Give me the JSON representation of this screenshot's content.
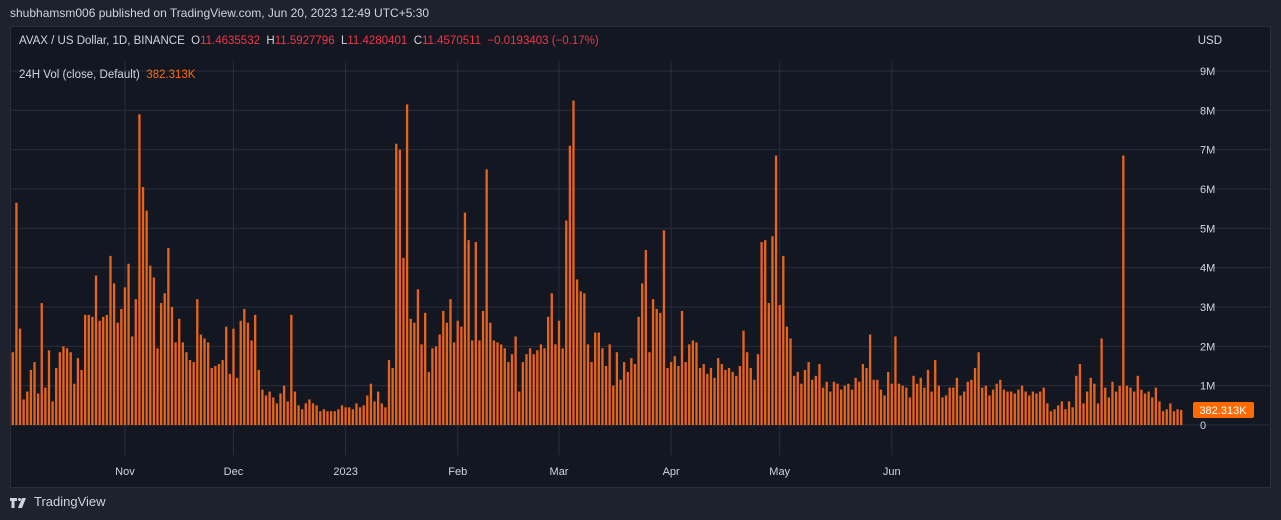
{
  "header": {
    "publisher_line": "shubhamsm006 published on TradingView.com, Jun 20, 2023 12:49 UTC+5:30"
  },
  "legend": {
    "symbol": "AVAX / US Dollar, 1D, BINANCE",
    "o_label": "O",
    "o_value": "11.4635532",
    "h_label": "H",
    "h_value": "11.5927796",
    "l_label": "L",
    "l_value": "11.4280401",
    "c_label": "C",
    "c_value": "11.4570511",
    "change": "−0.0193403 (−0.17%)",
    "currency": "USD"
  },
  "indicator": {
    "name": "24H Vol (close, Default)",
    "value": "382.313K"
  },
  "footer": {
    "brand": "TradingView"
  },
  "colors": {
    "bar": "#e8641c",
    "label_bg": "#ff6a00",
    "grid": "#2a2e39"
  },
  "chart_data": {
    "type": "bar",
    "series": [
      {
        "name": "24H Vol (close, Default)"
      }
    ],
    "y_ticks": [
      "0",
      "1M",
      "2M",
      "3M",
      "4M",
      "5M",
      "6M",
      "7M",
      "8M",
      "9M"
    ],
    "y_tick_values": [
      0,
      1000000,
      2000000,
      3000000,
      4000000,
      5000000,
      6000000,
      7000000,
      8000000,
      9000000
    ],
    "ylim": [
      0,
      9000000
    ],
    "x_ticks": [
      {
        "label": "Nov",
        "index": 31
      },
      {
        "label": "Dec",
        "index": 61
      },
      {
        "label": "2023",
        "index": 92
      },
      {
        "label": "Feb",
        "index": 123
      },
      {
        "label": "Mar",
        "index": 151
      },
      {
        "label": "Apr",
        "index": 182
      },
      {
        "label": "May",
        "index": 212
      },
      {
        "label": "Jun",
        "index": 243
      }
    ],
    "last_value_label": "382.313K",
    "last_value": 382313,
    "values": [
      1.85,
      5.65,
      2.45,
      0.65,
      0.85,
      1.4,
      1.6,
      0.8,
      3.1,
      0.95,
      1.9,
      0.6,
      1.45,
      1.85,
      2.0,
      1.95,
      1.85,
      1.05,
      1.7,
      1.4,
      2.8,
      2.8,
      2.75,
      3.8,
      2.65,
      2.75,
      2.8,
      4.3,
      3.6,
      2.6,
      2.95,
      3.5,
      4.1,
      2.25,
      3.2,
      7.9,
      6.05,
      5.45,
      4.05,
      3.75,
      1.95,
      3.1,
      3.35,
      4.5,
      3.0,
      2.1,
      2.7,
      2.1,
      1.85,
      1.65,
      1.6,
      3.2,
      2.3,
      2.2,
      2.1,
      1.45,
      1.5,
      1.55,
      1.65,
      2.5,
      1.3,
      2.45,
      1.2,
      2.65,
      2.95,
      2.6,
      2.15,
      2.8,
      1.4,
      0.9,
      0.75,
      0.85,
      0.7,
      0.55,
      0.8,
      1.0,
      0.6,
      2.8,
      0.85,
      0.5,
      0.4,
      0.55,
      0.65,
      0.55,
      0.5,
      0.35,
      0.4,
      0.35,
      0.35,
      0.35,
      0.4,
      0.5,
      0.45,
      0.45,
      0.4,
      0.55,
      0.45,
      0.5,
      0.75,
      1.05,
      0.6,
      0.85,
      0.55,
      0.45,
      1.65,
      1.45,
      7.15,
      7.0,
      4.25,
      8.15,
      2.7,
      2.6,
      3.45,
      2.05,
      2.85,
      1.35,
      1.95,
      2.0,
      2.3,
      2.9,
      2.6,
      3.2,
      2.1,
      2.65,
      2.5,
      5.4,
      4.7,
      2.15,
      4.65,
      2.15,
      2.9,
      6.5,
      2.6,
      2.15,
      2.1,
      2.05,
      1.95,
      1.6,
      1.8,
      2.25,
      0.85,
      1.6,
      1.8,
      1.95,
      1.8,
      1.9,
      2.05,
      1.95,
      2.75,
      3.35,
      2.05,
      2.65,
      1.95,
      5.2,
      7.1,
      8.25,
      3.7,
      3.4,
      3.35,
      2.05,
      1.6,
      2.35,
      2.35,
      1.95,
      1.5,
      2.05,
      1.0,
      1.85,
      1.15,
      1.6,
      1.35,
      1.7,
      1.55,
      2.75,
      3.6,
      4.45,
      1.85,
      3.2,
      2.95,
      2.85,
      4.95,
      1.45,
      1.6,
      1.75,
      1.5,
      2.9,
      1.6,
      2.05,
      2.15,
      2.1,
      1.45,
      1.55,
      1.3,
      1.45,
      1.2,
      1.7,
      1.55,
      1.4,
      1.45,
      1.35,
      1.25,
      1.5,
      2.4,
      1.85,
      1.45,
      1.15,
      1.8,
      4.65,
      4.7,
      3.1,
      4.8,
      6.85,
      3.05,
      4.3,
      2.5,
      2.2,
      1.25,
      1.35,
      1.05,
      1.4,
      1.6,
      1.15,
      1.25,
      1.55,
      0.95,
      1.1,
      0.85,
      1.1,
      1.05,
      0.9,
      1.0,
      1.05,
      0.9,
      1.2,
      1.1,
      1.55,
      1.45,
      2.3,
      1.15,
      1.15,
      0.9,
      0.75,
      1.35,
      1.05,
      2.25,
      1.05,
      1.0,
      0.95,
      0.7,
      1.25,
      1.05,
      1.2,
      0.95,
      1.4,
      0.85,
      1.65,
      1.0,
      0.7,
      0.75,
      0.95,
      0.95,
      1.2,
      0.75,
      0.85,
      1.1,
      1.15,
      1.45,
      1.85,
      0.95,
      1.0,
      0.75,
      0.9,
      1.05,
      1.15,
      0.9,
      0.85,
      0.85,
      0.8,
      0.9,
      1.0,
      0.85,
      0.75,
      0.85,
      0.8,
      0.85,
      0.95,
      0.55,
      0.35,
      0.4,
      0.5,
      0.6,
      0.4,
      0.6,
      0.45,
      1.25,
      1.55,
      0.55,
      0.85,
      1.2,
      1.05,
      0.55,
      2.2,
      0.95,
      0.7,
      1.1,
      0.85,
      1.0,
      6.85,
      1.0,
      0.95,
      0.85,
      1.25,
      0.9,
      0.8,
      0.85,
      0.7,
      0.95,
      0.6,
      0.35,
      0.4,
      0.55,
      0.35,
      0.4,
      0.38
    ]
  }
}
